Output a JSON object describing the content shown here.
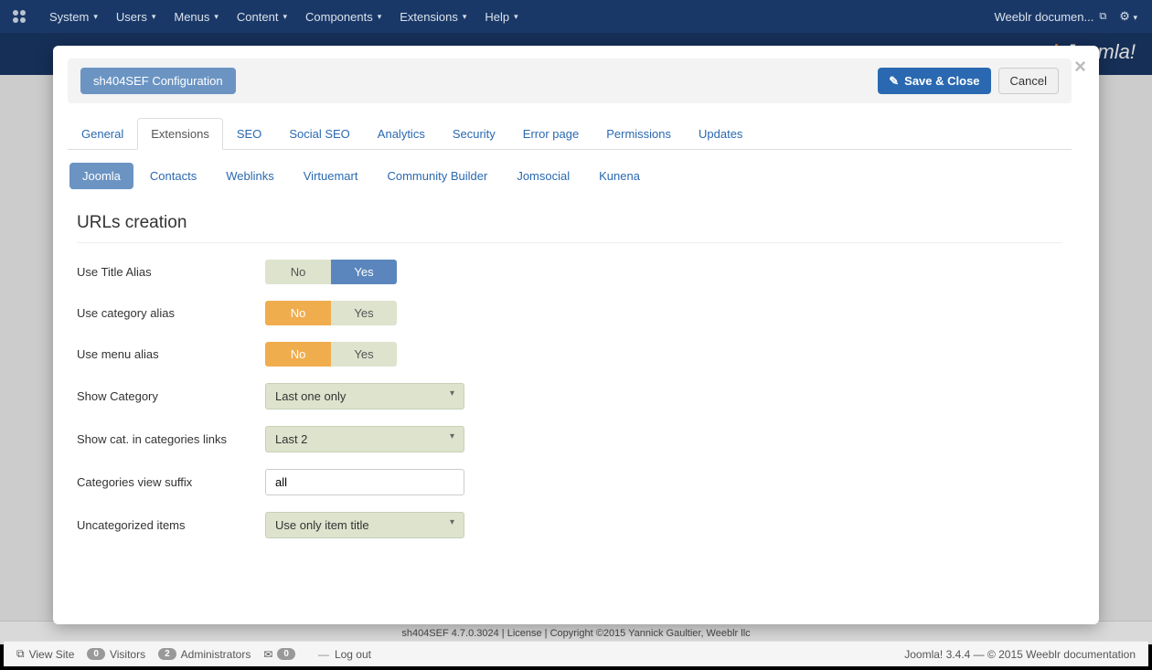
{
  "adminBar": {
    "menus": [
      "System",
      "Users",
      "Menus",
      "Content",
      "Components",
      "Extensions",
      "Help"
    ],
    "siteLink": "Weeblr documen..."
  },
  "brand": "Joomla!",
  "modal": {
    "configLabel": "sh404SEF Configuration",
    "saveLabel": "Save & Close",
    "cancelLabel": "Cancel",
    "tabs": [
      "General",
      "Extensions",
      "SEO",
      "Social SEO",
      "Analytics",
      "Security",
      "Error page",
      "Permissions",
      "Updates"
    ],
    "activeTab": "Extensions",
    "subtabs": [
      "Joomla",
      "Contacts",
      "Weblinks",
      "Virtuemart",
      "Community Builder",
      "Jomsocial",
      "Kunena"
    ],
    "activeSubtab": "Joomla",
    "sectionTitle": "URLs creation",
    "fields": {
      "useTitleAlias": {
        "label": "Use Title Alias",
        "no": "No",
        "yes": "Yes",
        "value": "yes"
      },
      "useCategoryAlias": {
        "label": "Use category alias",
        "no": "No",
        "yes": "Yes",
        "value": "no"
      },
      "useMenuAlias": {
        "label": "Use menu alias",
        "no": "No",
        "yes": "Yes",
        "value": "no"
      },
      "showCategory": {
        "label": "Show Category",
        "value": "Last one only"
      },
      "showCatInLinks": {
        "label": "Show cat. in categories links",
        "value": "Last 2"
      },
      "categoriesSuffix": {
        "label": "Categories view suffix",
        "value": "all"
      },
      "uncategorized": {
        "label": "Uncategorized items",
        "value": "Use only item title"
      }
    }
  },
  "bgFooter": "sh404SEF 4.7.0.3024 | License | Copyright ©2015 Yannick Gaultier, Weeblr llc",
  "statusBar": {
    "viewSite": "View Site",
    "visitors": {
      "count": "0",
      "label": "Visitors"
    },
    "admins": {
      "count": "2",
      "label": "Administrators"
    },
    "messages": "0",
    "logout": "Log out",
    "right": "Joomla! 3.4.4  —  © 2015 Weeblr documentation"
  }
}
